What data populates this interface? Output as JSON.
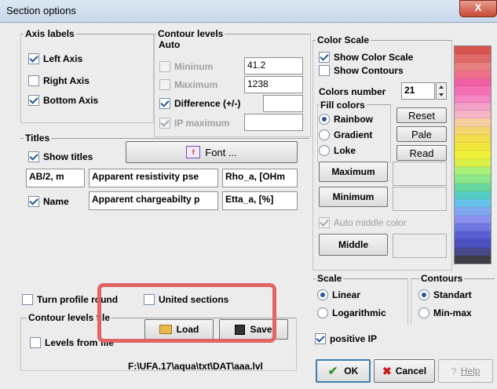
{
  "window": {
    "title": "Section options",
    "close_label": "X"
  },
  "axis_labels": {
    "title": "Axis labels",
    "left": "Left Axis",
    "right": "Right Axis",
    "bottom": "Bottom Axis"
  },
  "contour_levels": {
    "title": "Contour levels",
    "auto": "Auto",
    "minimum_label": "Mininum",
    "minimum_value": "41.2",
    "maximum_label": "Maximum",
    "maximum_value": "1238",
    "difference_label": "Difference (+/-)",
    "difference_value": "",
    "ip_max_label": "IP maximum",
    "ip_max_value": ""
  },
  "titles": {
    "title": "Titles",
    "show_titles": "Show titles",
    "font_button": "Font ...",
    "row1": [
      "AB/2, m",
      "Apparent resistivity pse",
      "Rho_a, [OHm"
    ],
    "name_label": "Name",
    "row2": [
      "Apparent chargeabilty p",
      "Etta_a, [%]"
    ]
  },
  "color_scale": {
    "title": "Color Scale",
    "show_color_scale": "Show Color Scale",
    "show_contours": "Show Contours",
    "colors_number_label": "Colors number",
    "colors_number_value": "21",
    "fill_colors_title": "Fill colors",
    "fill_options": [
      "Rainbow",
      "Gradient",
      "Loke"
    ],
    "reset": "Reset",
    "pale": "Pale",
    "read": "Read",
    "maximum": "Maximum",
    "minimum": "Minimum",
    "auto_middle": "Auto middle color",
    "middle": "Middle",
    "swatches": [
      "#d9534f",
      "#e06a6a",
      "#e67f7f",
      "#ef6f8a",
      "#f25fa3",
      "#f46fb3",
      "#f585c2",
      "#f3a0c8",
      "#f7b4c4",
      "#f6cfa0",
      "#f5d56e",
      "#f2dd4a",
      "#f0e63a",
      "#eef03a",
      "#d8f048",
      "#a8f07a",
      "#8ee68a",
      "#66d89e",
      "#55cfc4",
      "#66c4ec",
      "#7fa8f0",
      "#8a90ee",
      "#6f78e0",
      "#5a5fd4",
      "#4b50c0",
      "#474a8a",
      "#3e3e46"
    ]
  },
  "bottom_left": {
    "turn_profile": "Turn profile round",
    "united_sections": "United sections",
    "contour_file_title": "Contour levels file",
    "levels_from_file": "Levels from file",
    "load": "Load",
    "save": "Save",
    "path": "F:\\UFA.17\\aqua\\txt\\DAT\\aaa.lvl"
  },
  "scale": {
    "title": "Scale",
    "linear": "Linear",
    "logarithmic": "Logarithmic"
  },
  "contours": {
    "title": "Contours",
    "standart": "Standart",
    "minmax": "Min-max"
  },
  "positive_ip": "positive IP",
  "buttons": {
    "ok": "OK",
    "cancel": "Cancel",
    "help": "Help"
  }
}
